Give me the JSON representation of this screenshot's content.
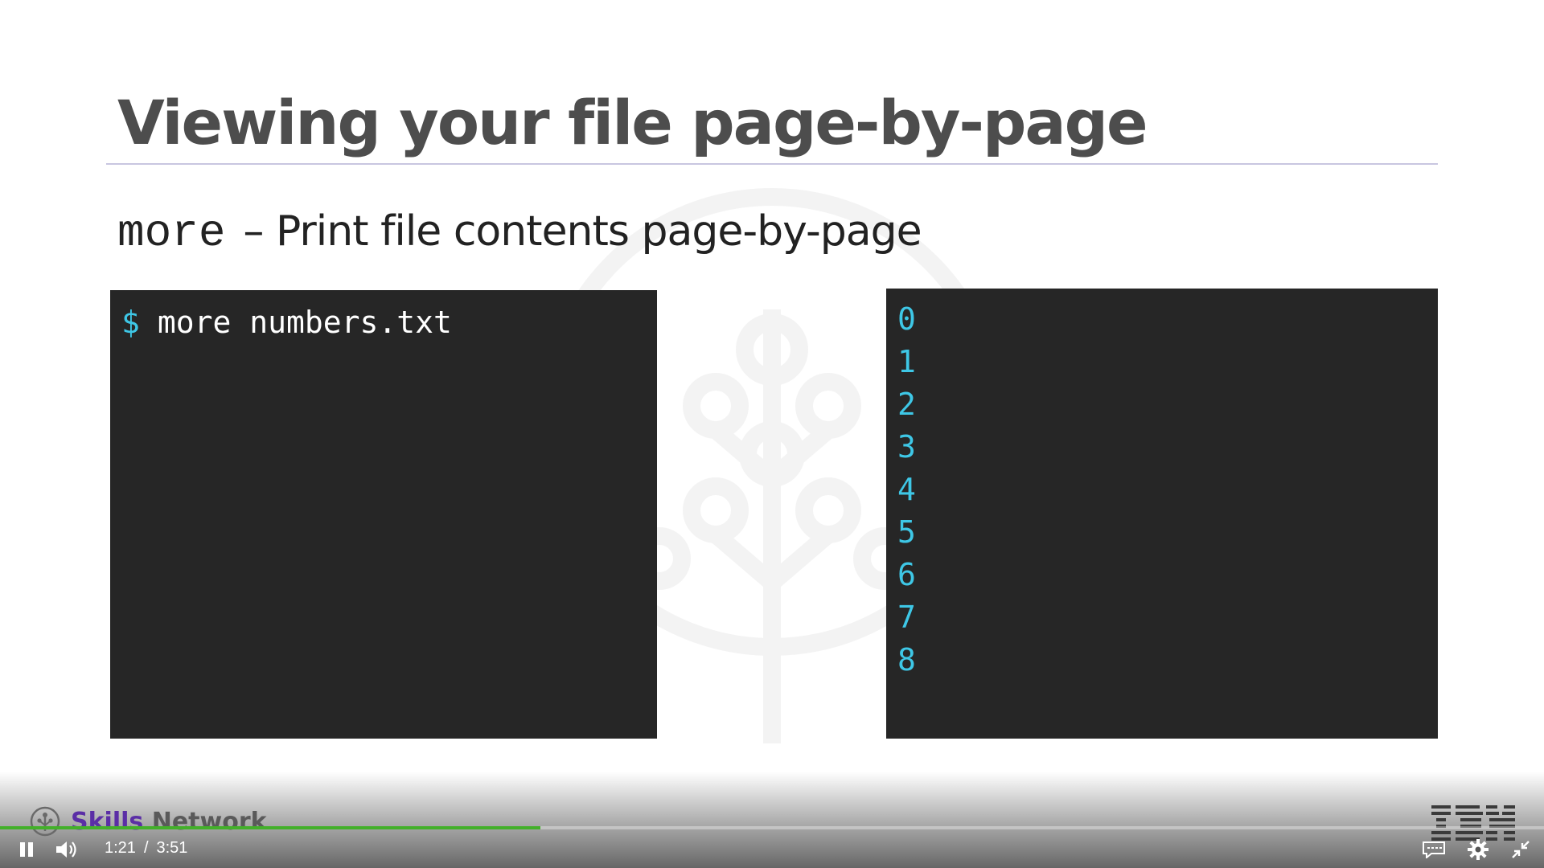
{
  "slide": {
    "title": "Viewing your file page-by-page",
    "command": "more",
    "description": "– Print file contents page-by-page",
    "terminal_left": {
      "prompt": "$",
      "command_text": "more numbers.txt"
    },
    "terminal_right": {
      "lines": [
        "0",
        "1",
        "2",
        "3",
        "4",
        "5",
        "6",
        "7",
        "8"
      ]
    }
  },
  "player": {
    "brand_primary": "Skills",
    "brand_secondary": "Network",
    "current_time": "1:21",
    "separator": "/",
    "duration": "3:51",
    "progress_fraction": 0.35,
    "icons": {
      "play_pause": "pause-icon",
      "volume": "volume-icon",
      "captions": "captions-icon",
      "settings": "gear-icon",
      "exit_fullscreen": "exit-fullscreen-icon"
    }
  },
  "colors": {
    "terminal_bg": "#262626",
    "terminal_accent": "#3ec7e6",
    "progress": "#43b02a",
    "brand": "#5b2ea6"
  }
}
